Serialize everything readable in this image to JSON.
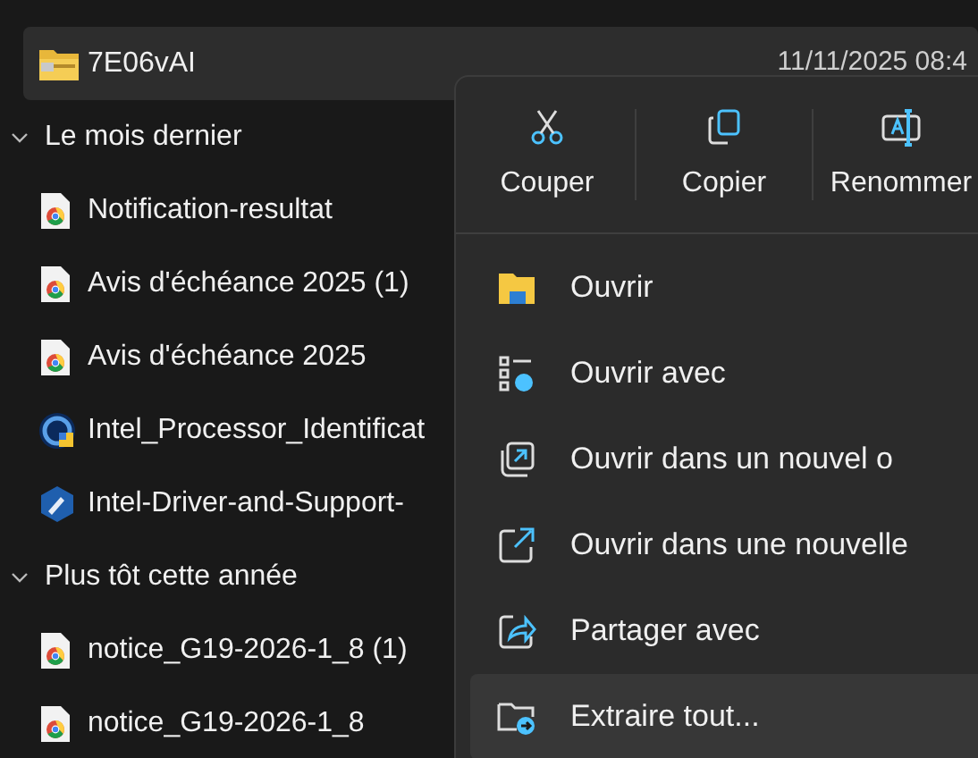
{
  "file_list": {
    "groups": [
      {
        "items": [
          {
            "name": "7E06vAI",
            "kind": "zip",
            "selected": true,
            "date": "11/11/2025 08:4"
          }
        ]
      },
      {
        "header": "Le mois dernier",
        "expanded": true,
        "items": [
          {
            "name": "Notification-resultat",
            "kind": "pdf",
            "selected": false
          },
          {
            "name": "Avis d'échéance 2025 (1)",
            "kind": "pdf",
            "selected": false
          },
          {
            "name": "Avis d'échéance 2025",
            "kind": "pdf",
            "selected": false
          },
          {
            "name": "Intel_Processor_Identificat",
            "kind": "setup",
            "selected": false
          },
          {
            "name": "Intel-Driver-and-Support-",
            "kind": "driver",
            "selected": false
          }
        ]
      },
      {
        "header": "Plus tôt cette année",
        "expanded": true,
        "items": [
          {
            "name": "notice_G19-2026-1_8 (1)",
            "kind": "pdf",
            "selected": false
          },
          {
            "name": "notice_G19-2026-1_8",
            "kind": "pdf",
            "selected": false
          }
        ]
      }
    ]
  },
  "context_menu": {
    "toolbar": [
      {
        "label": "Couper",
        "kind": "cut"
      },
      {
        "label": "Copier",
        "kind": "copy"
      },
      {
        "label": "Renommer",
        "kind": "rename"
      }
    ],
    "items": [
      {
        "label": "Ouvrir",
        "kind": "open",
        "selected": false
      },
      {
        "label": "Ouvrir avec",
        "kind": "open_with",
        "selected": false
      },
      {
        "label": "Ouvrir dans un nouvel o",
        "kind": "new_tab",
        "selected": false
      },
      {
        "label": "Ouvrir dans une nouvelle",
        "kind": "new_window",
        "selected": false
      },
      {
        "label": "Partager avec",
        "kind": "share",
        "selected": false
      },
      {
        "label": "Extraire tout...",
        "kind": "extract",
        "selected": true
      }
    ]
  }
}
